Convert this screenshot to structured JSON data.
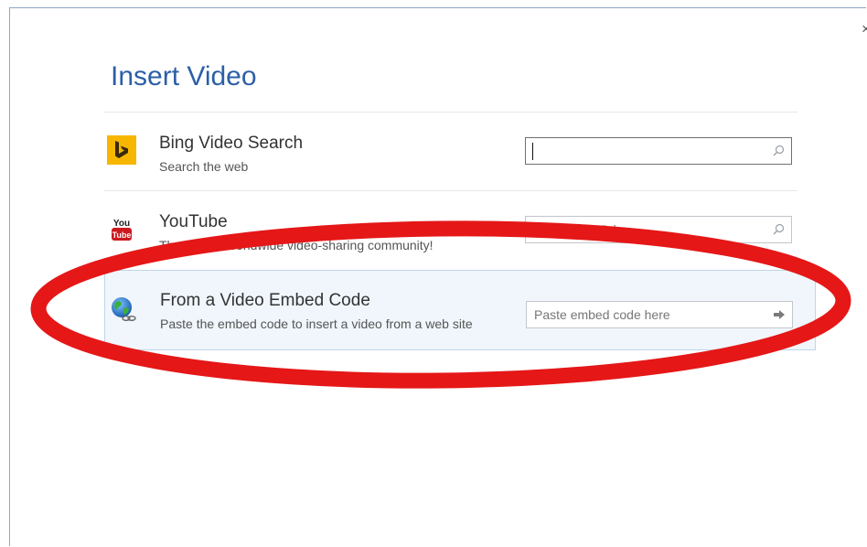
{
  "dialog": {
    "title": "Insert Video",
    "close_glyph": "×"
  },
  "sources": [
    {
      "icon": "bing-logo-icon",
      "title": "Bing Video Search",
      "description": "Search the web",
      "input_value": "",
      "input_placeholder": "",
      "action_icon": "search-icon"
    },
    {
      "icon": "youtube-logo-icon",
      "logo_top": "You",
      "logo_bottom": "Tube",
      "title": "YouTube",
      "description": "The largest worldwide video-sharing community!",
      "input_value": "",
      "input_placeholder": "Search YouTube",
      "action_icon": "search-icon"
    },
    {
      "icon": "globe-link-icon",
      "title": "From a Video Embed Code",
      "description": "Paste the embed code to insert a video from a web site",
      "input_value": "",
      "input_placeholder": "Paste embed code here",
      "action_icon": "arrow-right-icon"
    }
  ],
  "colors": {
    "title": "#2c5fa6",
    "bing": "#f7b600",
    "youtube": "#cc181e",
    "annotation": "#e51717",
    "selected_row": "#f0f6fb"
  },
  "annotation": {
    "shape": "ellipse",
    "target": "From a Video Embed Code"
  }
}
